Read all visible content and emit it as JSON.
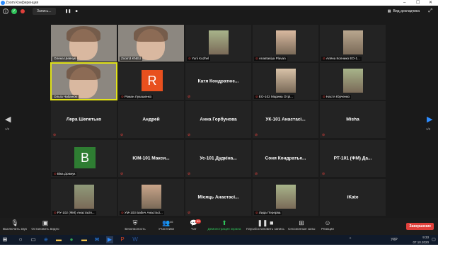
{
  "window": {
    "title": "Zoom Конференция",
    "minimize": "–",
    "maximize": "☐",
    "close": "✕"
  },
  "topbar": {
    "recording_label": "Запись...",
    "pause_glyph": "❚❚",
    "stop_glyph": "■",
    "view_label": "Вид докладчика",
    "fullscreen_glyph": "⤢"
  },
  "participants": [
    {
      "label": "Олена Шевчук",
      "type": "video",
      "mic": false
    },
    {
      "label": "Zoom3 KNEU",
      "type": "video",
      "mic": false
    },
    {
      "label": "Yurii Kuzhel",
      "type": "photo",
      "mic": true
    },
    {
      "label": "Anastasiya Plavan",
      "type": "photo",
      "mic": true
    },
    {
      "label": "Алёна Колнико ЕО-1...",
      "type": "photo",
      "mic": true
    },
    {
      "label": "Ольга Чабанюк",
      "type": "video",
      "mic": false,
      "active": true
    },
    {
      "label": "Роман Лукашенко",
      "type": "avatar",
      "avatar_letter": "R",
      "avatar_color": "#e8501e",
      "mic": true
    },
    {
      "name": "Катя Кондратює...",
      "type": "text",
      "mic": true
    },
    {
      "label": "ЕО-102 Марина Отрі...",
      "type": "photo",
      "mic": true
    },
    {
      "label": "Настя Юрченко",
      "type": "photo",
      "mic": true
    },
    {
      "name": "Лера Шепетько",
      "type": "text",
      "mic": true
    },
    {
      "name": "Андрей",
      "type": "text",
      "mic": true
    },
    {
      "name": "Анна Горбунова",
      "type": "text",
      "mic": true
    },
    {
      "name": "УК-101 Анастасі...",
      "type": "text",
      "mic": true
    },
    {
      "name": "Misha",
      "type": "text",
      "mic": true
    },
    {
      "label": "Віка Довжук",
      "type": "avatar",
      "avatar_letter": "B",
      "avatar_color": "#2e7d32",
      "mic": true
    },
    {
      "name": "ЮМ-101 Макси...",
      "type": "text",
      "mic": true
    },
    {
      "name": "Ус-101 Дудкіна...",
      "type": "text",
      "mic": true
    },
    {
      "name": "Соня Кондратье...",
      "type": "text",
      "mic": true
    },
    {
      "name": "РТ-101 (ФМ) Да...",
      "type": "text",
      "mic": true
    },
    {
      "label": "РУ-102 (ФМ) Анастасія...",
      "type": "photo",
      "mic": true
    },
    {
      "label": "УМ-103 Бабич Анастасі...",
      "type": "photo",
      "mic": true
    },
    {
      "name": "Місяць Анастасі...",
      "type": "text",
      "mic": true
    },
    {
      "label": "Лида Перерва",
      "type": "photo",
      "mic": true
    },
    {
      "name": "iKate",
      "type": "text",
      "mic": false
    }
  ],
  "pager": {
    "left_arrow": "◀",
    "right_arrow": "▶",
    "left_page": "1/2",
    "right_page": "1/2"
  },
  "toolbar": {
    "mute_label": "Выключить звук",
    "video_label": "Остановить видео",
    "security_label": "Безопасность",
    "participants_label": "Участники",
    "participants_count": "46",
    "chat_label": "Чат",
    "chat_badge": "99",
    "share_label": "Демонстрация экрана",
    "record_label": "Пауза/остановить запись",
    "breakout_label": "Сессионные залы",
    "reactions_label": "Реакции",
    "end_label": "Завершение"
  },
  "taskbar": {
    "time": "9:33",
    "date": "07.10.2020",
    "lang": "УКР"
  },
  "colors": {
    "accent": "#2d8cff",
    "danger": "#e0403b",
    "share": "#2fc35a",
    "active_speaker": "#e1e21a"
  }
}
